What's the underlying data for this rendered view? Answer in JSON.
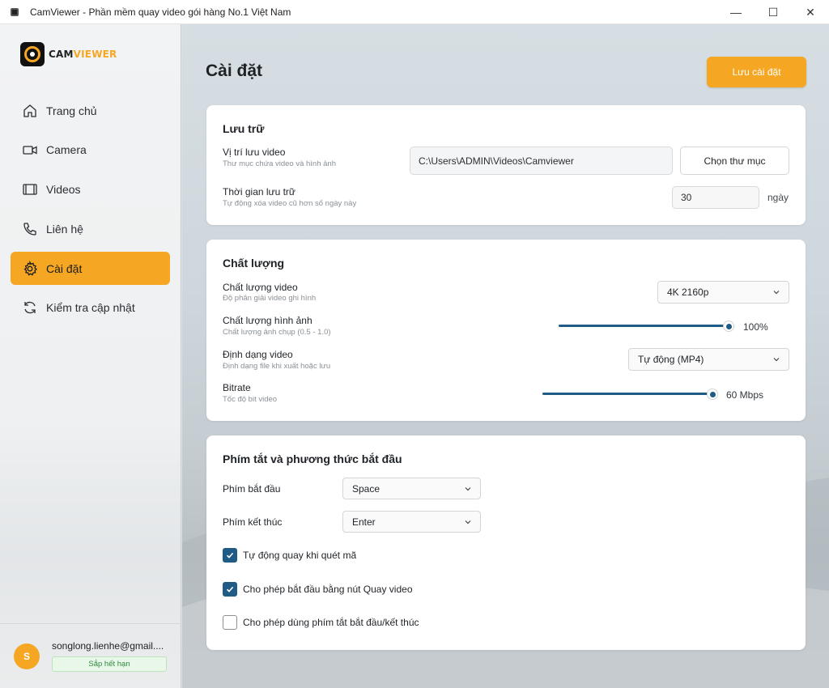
{
  "window": {
    "title": "CamViewer - Phần mềm quay video gói hàng No.1 Việt Nam",
    "buttons": {
      "minimize": "—",
      "maximize": "☐",
      "close": "✕"
    }
  },
  "brand": {
    "name_dark": "CAM",
    "name_accent": "VIEWER",
    "accent_color": "#f5a623"
  },
  "sidebar": {
    "items": [
      {
        "label": "Trang chủ",
        "icon": "home-icon",
        "active": false
      },
      {
        "label": "Camera",
        "icon": "camera-icon",
        "active": false
      },
      {
        "label": "Videos",
        "icon": "film-icon",
        "active": false
      },
      {
        "label": "Liên hệ",
        "icon": "phone-icon",
        "active": false
      },
      {
        "label": "Cài đặt",
        "icon": "gear-icon",
        "active": true
      },
      {
        "label": "Kiểm tra cập nhật",
        "icon": "refresh-icon",
        "active": false
      }
    ],
    "user": {
      "avatar_letter": "S",
      "email": "songlong.lienhe@gmail....",
      "badge": "Sắp hết hạn"
    }
  },
  "page": {
    "title": "Cài đặt",
    "save_button": "Lưu cài đặt"
  },
  "storage": {
    "title": "Lưu trữ",
    "location_label": "Vị trí lưu video",
    "location_sub": "Thư mục chứa video và hình ảnh",
    "location_value": "C:\\Users\\ADMIN\\Videos\\Camviewer",
    "choose_folder": "Chọn thư mục",
    "retention_label": "Thời gian lưu trữ",
    "retention_sub": "Tự động xóa video cũ hơn số ngày này",
    "retention_value": "30",
    "retention_unit": "ngày"
  },
  "quality": {
    "title": "Chất lượng",
    "video_label": "Chất lượng video",
    "video_sub": "Độ phân giải video ghi hình",
    "video_value": "4K 2160p",
    "image_label": "Chất lượng hình ảnh",
    "image_sub": "Chất lượng ảnh chụp (0.5 - 1.0)",
    "image_value": "100%",
    "image_level": 1.0,
    "format_label": "Định dạng video",
    "format_sub": "Định dạng file khi xuất hoặc lưu",
    "format_value": "Tự động (MP4)",
    "bitrate_label": "Bitrate",
    "bitrate_sub": "Tốc độ bit video",
    "bitrate_value": "60 Mbps",
    "bitrate_level": 1.0
  },
  "shortcuts": {
    "title": "Phím tắt và phương thức bắt đầu",
    "start_label": "Phím bắt đầu",
    "start_value": "Space",
    "end_label": "Phím kết thúc",
    "end_value": "Enter",
    "options": [
      {
        "label": "Tự động quay khi quét mã",
        "checked": true
      },
      {
        "label": "Cho phép bắt đầu bằng nút Quay video",
        "checked": true
      },
      {
        "label": "Cho phép dùng phím tắt bắt đầu/kết thúc",
        "checked": false
      }
    ]
  },
  "colors": {
    "primary_accent": "#f5a623",
    "slider": "#1f5b85",
    "checkbox": "#1f5b85"
  }
}
